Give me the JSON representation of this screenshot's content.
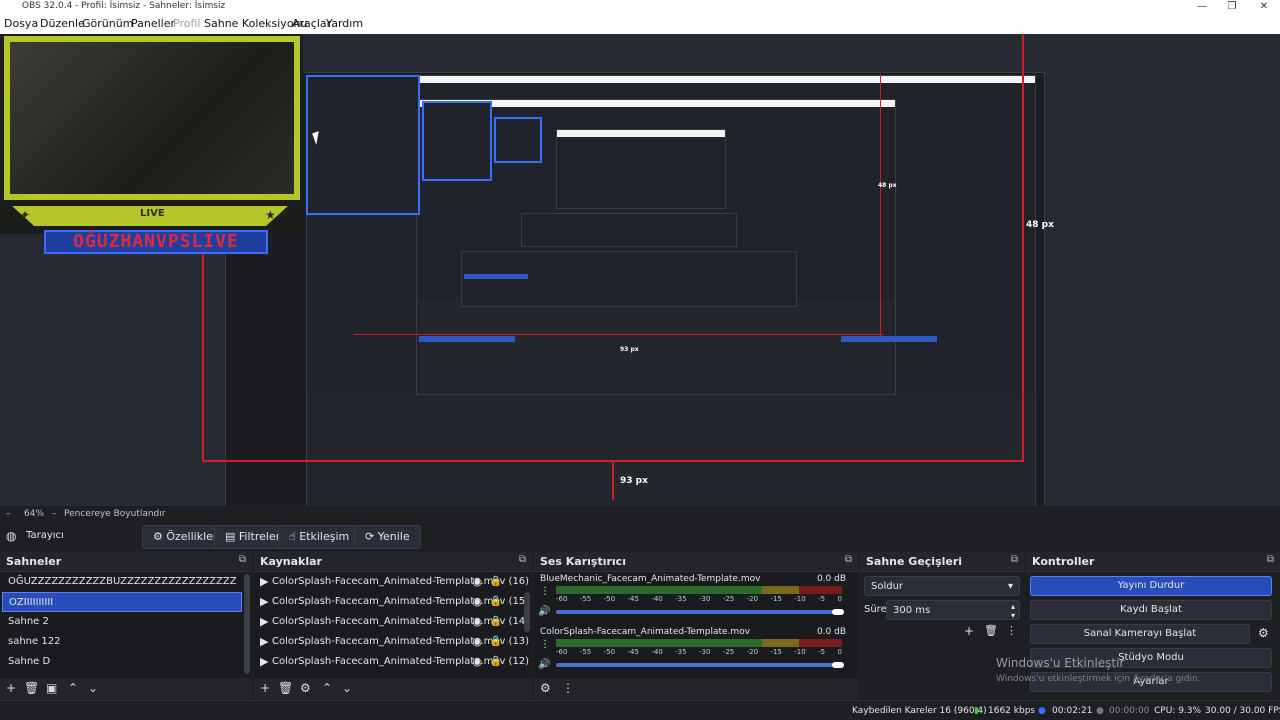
{
  "window": {
    "title": "OBS 32.0.4 - Profil: İsimsiz - Sahneler: İsimsiz",
    "minimize": "—",
    "maximize": "❐",
    "close": "✕"
  },
  "menu": {
    "items": [
      "Dosya",
      "Düzenle",
      "Görünüm",
      "Paneller",
      "Profil",
      "Sahne Koleksiyonu",
      "Araçlar",
      "Yardım"
    ]
  },
  "preview": {
    "facecam_live": "LIVE",
    "facecam_name": "OĞUZHANVPSLIVE",
    "measure_right": "48 px",
    "measure_bottom": "93 px",
    "nested_measure_a": "48 px",
    "nested_measure_b": "93 px"
  },
  "zoombar": {
    "zoom": "64%",
    "mode": "Pencereye Boyutlandır"
  },
  "toolbar": {
    "source_label": "Tarayıcı",
    "properties": "Özellikler",
    "filters": "Filtreler",
    "interact": "Etkileşim",
    "refresh": "Yenile"
  },
  "scenes": {
    "title": "Sahneler",
    "items": [
      "OĞUZZZZZZZZZZZBUZZZZZZZZZZZZZZZZZZZ",
      "OZIIIIIIIIII",
      "Sahne 2",
      "sahne 122",
      "Sahne D"
    ],
    "selected": 1
  },
  "sources": {
    "title": "Kaynaklar",
    "items": [
      "ColorSplash-Facecam_Animated-Template.mov (16)",
      "ColorSplash-Facecam_Animated-Template.mov (15)",
      "ColorSplash-Facecam_Animated-Template.mov (14)",
      "ColorSplash-Facecam_Animated-Template.mov (13)",
      "ColorSplash-Facecam_Animated-Template.mov (12)"
    ]
  },
  "mixer": {
    "title": "Ses Karıştırıcı",
    "ticks": [
      "-60",
      "-55",
      "-50",
      "-45",
      "-40",
      "-35",
      "-30",
      "-25",
      "-20",
      "-15",
      "-10",
      "-5",
      "0"
    ],
    "channels": [
      {
        "name": "BlueMechanic_Facecam_Animated-Template.mov",
        "db": "0.0 dB",
        "volume": 1.0
      },
      {
        "name": "ColorSplash-Facecam_Animated-Template.mov",
        "db": "0.0 dB",
        "volume": 1.0
      }
    ]
  },
  "transitions": {
    "title": "Sahne Geçişleri",
    "type": "Soldur",
    "duration_label": "Süre",
    "duration": "300 ms"
  },
  "controls": {
    "title": "Kontroller",
    "stop_stream": "Yayını Durdur",
    "start_recording": "Kaydı Başlat",
    "virtual_cam": "Sanal Kamerayı Başlat",
    "studio_mode": "Stüdyo Modu",
    "settings": "Ayarlar",
    "activate_title": "Windows'u Etkinleştir",
    "activate_sub": "Windows'u etkinleştirmek için Ayarlar'a gidin."
  },
  "status": {
    "dropped": "Kaybedilen Kareler 16 (960.4)",
    "bitrate": "1662 kbps",
    "stream_time": "00:02:21",
    "rec_time": "00:00:00",
    "cpu": "CPU: 9.3%",
    "fps": "30.00 / 30.00 FPS"
  },
  "colors": {
    "accent": "#284cb8",
    "measure": "#d11a2a",
    "facecam_frame": "#b5c62b"
  }
}
